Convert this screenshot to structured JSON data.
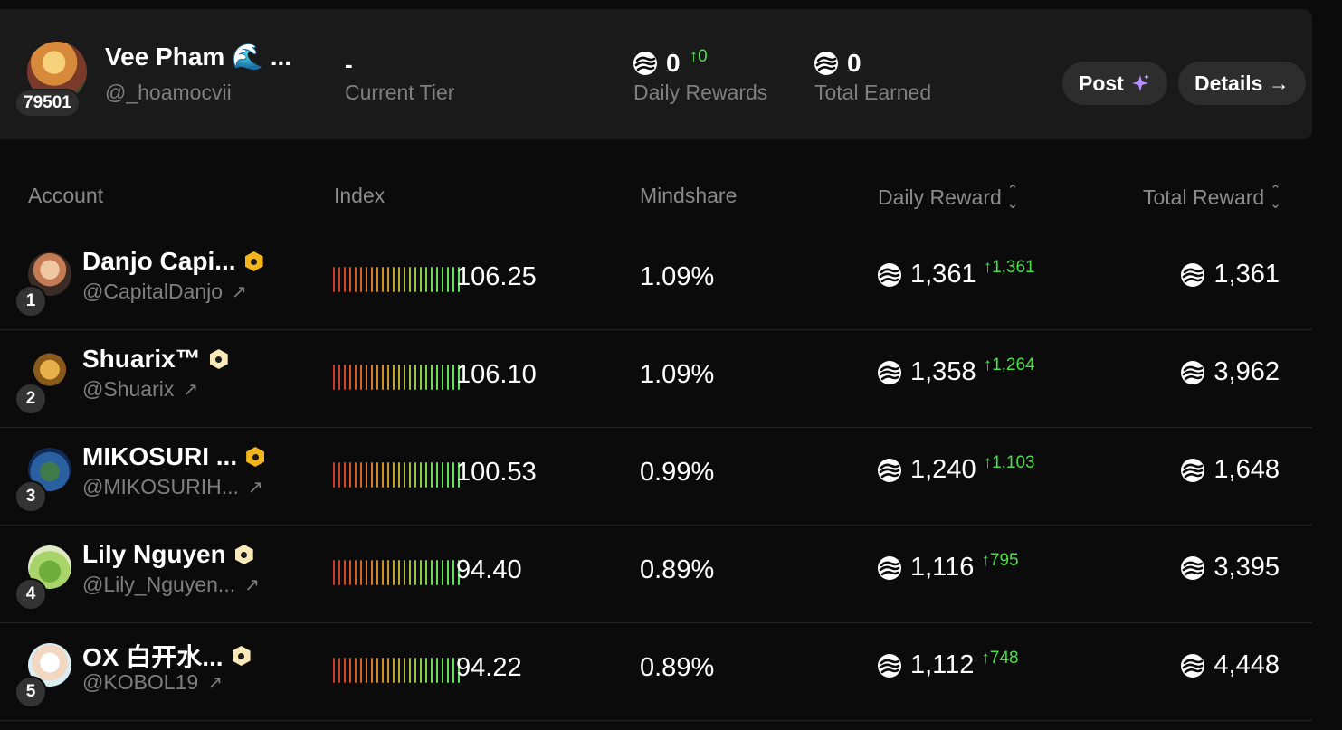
{
  "me": {
    "name": "Vee Pham 🌊 ...",
    "handle": "@_hoamocvii",
    "rank": "79501",
    "tier_value": "-",
    "tier_label": "Current Tier",
    "daily_rewards_value": "0",
    "daily_rewards_delta": "↑0",
    "daily_rewards_label": "Daily Rewards",
    "total_earned_value": "0",
    "total_earned_label": "Total Earned",
    "post_label": "Post",
    "details_label": "Details →"
  },
  "table": {
    "headers": {
      "account": "Account",
      "index": "Index",
      "mindshare": "Mindshare",
      "daily_reward": "Daily Reward",
      "total_reward": "Total Reward"
    },
    "rows": [
      {
        "rank": "1",
        "name": "Danjo Capi...",
        "handle": "@CapitalDanjo",
        "badge": "gold",
        "index": "106.25",
        "mindshare": "1.09%",
        "daily": "1,361",
        "delta": "↑1,361",
        "total": "1,361"
      },
      {
        "rank": "2",
        "name": "Shuarix™",
        "handle": "@Shuarix",
        "badge": "pale",
        "index": "106.10",
        "mindshare": "1.09%",
        "daily": "1,358",
        "delta": "↑1,264",
        "total": "3,962"
      },
      {
        "rank": "3",
        "name": "MIKOSURI ...",
        "handle": "@MIKOSURIH...",
        "badge": "gold",
        "index": "100.53",
        "mindshare": "0.99%",
        "daily": "1,240",
        "delta": "↑1,103",
        "total": "1,648"
      },
      {
        "rank": "4",
        "name": "Lily Nguyen",
        "handle": "@Lily_Nguyen...",
        "badge": "pale",
        "index": "94.40",
        "mindshare": "0.89%",
        "daily": "1,116",
        "delta": "↑795",
        "total": "3,395"
      },
      {
        "rank": "5",
        "name": "OX 白开水...",
        "handle": "@KOBOL19",
        "badge": "pale",
        "index": "94.22",
        "mindshare": "0.89%",
        "daily": "1,112",
        "delta": "↑748",
        "total": "4,448"
      }
    ]
  },
  "colors": {
    "background": "#0b0b0b",
    "card": "#1a1a1a",
    "positive": "#4ade4a",
    "muted": "#7f7f7f",
    "badge_gold": "#f2b51b",
    "badge_pale": "#fae9b8"
  }
}
